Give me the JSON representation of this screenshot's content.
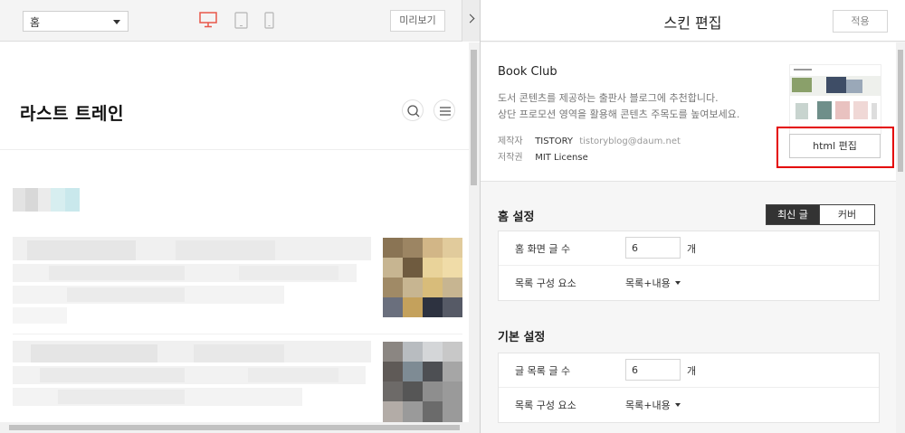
{
  "preview": {
    "page_select": "홈",
    "preview_button": "미리보기",
    "blog_title": "라스트 트레인"
  },
  "editor": {
    "title": "스킨 편집",
    "apply_button": "적용",
    "skin": {
      "name": "Book Club",
      "description_line1": "도서 콘텐츠를 제공하는 출판사 블로그에 추천합니다.",
      "description_line2": "상단 프로모션 영역을 활용해 콘텐츠 주목도를 높여보세요.",
      "maker_label": "제작자",
      "maker": "TISTORY",
      "maker_email": "tistoryblog@daum.net",
      "license_label": "저작권",
      "license": "MIT License",
      "html_edit_button": "html 편집"
    },
    "home_settings": {
      "title": "홈 설정",
      "tabs": [
        "최신 글",
        "커버"
      ],
      "active_tab": "최신 글",
      "post_count_label": "홈 화면 글 수",
      "post_count": "6",
      "post_count_unit": "개",
      "list_component_label": "목록 구성 요소",
      "list_component": "목록+내용"
    },
    "basic_settings": {
      "title": "기본 설정",
      "post_count_label": "글 목록 글 수",
      "post_count": "6",
      "post_count_unit": "개",
      "list_component_label": "목록 구성 요소",
      "list_component": "목록+내용"
    }
  },
  "colors": {
    "highlight": "#e40000",
    "active_device": "#e8574a",
    "segment_active": "#333333"
  },
  "icons": [
    "chevron-down-icon",
    "desktop-icon",
    "tablet-icon",
    "mobile-icon",
    "chevron-right-icon",
    "search-icon",
    "menu-icon",
    "caret-down-icon"
  ]
}
